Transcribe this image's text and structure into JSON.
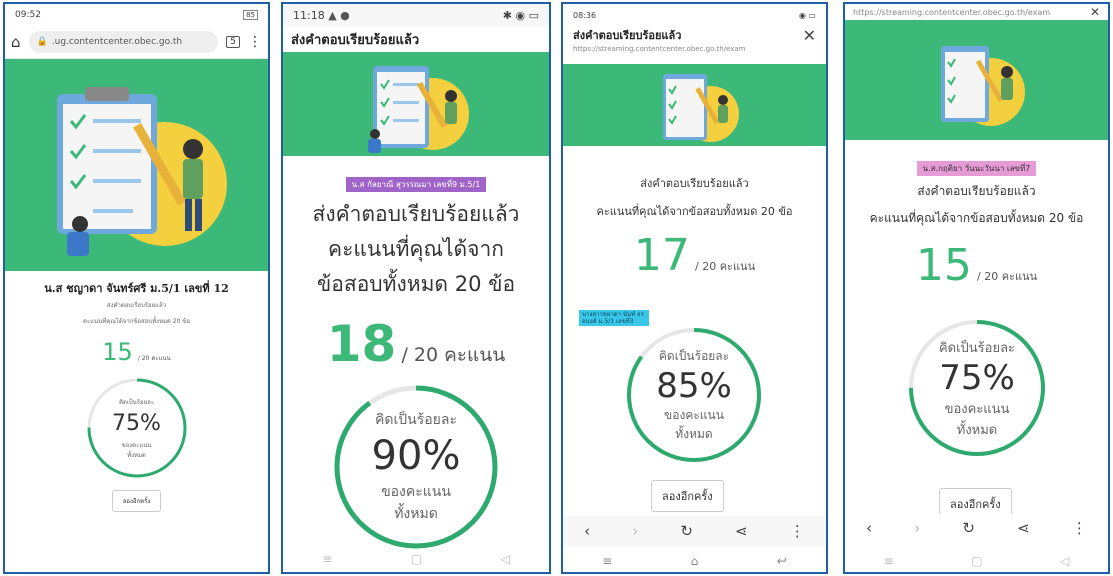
{
  "colors": {
    "accent": "#3cb878",
    "ring": "#2eaa6e",
    "frame": "#1f5fa8",
    "tag_purple": "#a064c8",
    "tag_pink": "#e79bd6",
    "tag_cyan": "#38c7e8"
  },
  "p1": {
    "time": "09:52",
    "battery": "85",
    "url": ".ug.contentcenter.obec.go.th",
    "name": "น.ส ชญาดา จันทร์ศรี ม.5/1 เลขที่ 12",
    "sent": "ส่งคำตอบเรียบร้อยแล้ว",
    "score_line": "คะแนนที่คุณได้จากข้อสอบทั้งหมด 20 ข้อ",
    "score": "15",
    "score_suffix": "/ 20 คะแนน",
    "percent_label": "คิดเป็นร้อยละ",
    "percent": "75%",
    "of_total": "ของคะแนน",
    "total": "ทั้งหมด",
    "retry": "ลองอีกครั้ง",
    "percent_value": 0.75
  },
  "p2": {
    "time": "11:18",
    "header": "ส่งคำตอบเรียบร้อยแล้ว",
    "name": "น.ส กัลยาณี สุวรรณมา เลขที่9 ม.5/1",
    "sent": "ส่งคำตอบเรียบร้อยแล้ว",
    "line2": "คะแนนที่คุณได้จาก",
    "line3": "ข้อสอบทั้งหมด 20 ข้อ",
    "score": "18",
    "score_suffix": "/ 20 คะแนน",
    "percent_label": "คิดเป็นร้อยละ",
    "percent": "90%",
    "of_total": "ของคะแนน",
    "total": "ทั้งหมด",
    "percent_value": 0.9
  },
  "p3": {
    "time": "08:36",
    "header": "ส่งคำตอบเรียบร้อยแล้ว",
    "url": "https://streaming.contentcenter.obec.go.th/exam",
    "sent": "ส่งคำตอบเรียบร้อยแล้ว",
    "score_line": "คะแนนที่คุณได้จากข้อสอบทั้งหมด 20 ข้อ",
    "score": "17",
    "score_suffix": "/ 20 คะแนน",
    "name_small": "นางสาวชยาดา นันท์ อรอนงค์ ม.5/1 เลขที่3",
    "percent_label": "คิดเป็นร้อยละ",
    "percent": "85%",
    "of_total": "ของคะแนน",
    "total": "ทั้งหมด",
    "retry": "ลองอีกครั้ง",
    "percent_value": 0.85
  },
  "p4": {
    "url": "https://streaming.contentcenter.obec.go.th/exam",
    "name": "น.ส.กฤติยา วันนะวันนา เลขที่7",
    "sent": "ส่งคำตอบเรียบร้อยแล้ว",
    "score_line": "คะแนนที่คุณได้จากข้อสอบทั้งหมด 20 ข้อ",
    "score": "15",
    "score_suffix": "/ 20 คะแนน",
    "percent_label": "คิดเป็นร้อยละ",
    "percent": "75%",
    "of_total": "ของคะแนน",
    "total": "ทั้งหมด",
    "retry": "ลองอีกครั้ง",
    "percent_value": 0.75
  }
}
